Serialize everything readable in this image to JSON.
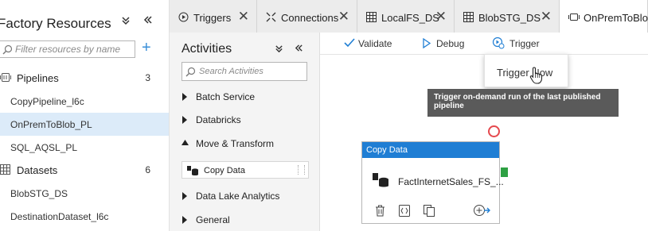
{
  "factory_resources": {
    "title": "Factory Resources",
    "search_placeholder": "Filter resources by name",
    "add_label": "+",
    "groups": [
      {
        "label": "Pipelines",
        "count": "3",
        "icon": "pipeline-icon"
      },
      {
        "label": "Datasets",
        "count": "6",
        "icon": "dataset-table-icon"
      }
    ],
    "pipelines": [
      "CopyPipeline_l6c",
      "OnPremToBlob_PL",
      "SQL_AQSL_PL"
    ],
    "datasets": [
      "BlobSTG_DS",
      "DestinationDataset_l6c"
    ],
    "selected_item": "OnPremToBlob_PL"
  },
  "tabs": [
    {
      "label": "Triggers",
      "icon": "trigger-icon",
      "closable": true
    },
    {
      "label": "Connections",
      "icon": "connections-icon",
      "closable": true
    },
    {
      "label": "LocalFS_DS",
      "icon": "dataset-table-icon",
      "closable": true
    },
    {
      "label": "BlobSTG_DS",
      "icon": "dataset-table-icon",
      "closable": true
    },
    {
      "label": "OnPremToBlob",
      "icon": "pipeline-icon",
      "closable": false
    }
  ],
  "tab_close_glyph": "✕",
  "activities": {
    "title": "Activities",
    "search_placeholder": "Search Activities",
    "categories": [
      {
        "label": "Batch Service",
        "expanded": false
      },
      {
        "label": "Databricks",
        "expanded": false
      },
      {
        "label": "Move & Transform",
        "expanded": true
      },
      {
        "label": "Data Lake Analytics",
        "expanded": false
      },
      {
        "label": "General",
        "expanded": false
      }
    ],
    "copy_data_label": "Copy Data"
  },
  "toolbar": {
    "validate_label": "Validate",
    "debug_label": "Debug",
    "trigger_label": "Trigger"
  },
  "trigger_menu": {
    "trigger_now_label": "Trigger Now"
  },
  "tooltip": {
    "text": "Trigger on-demand run of the last published pipeline"
  },
  "activity_box": {
    "header": "Copy Data",
    "name": "FactInternetSales_FS_..."
  },
  "glyphs": {
    "collapse_down": "≚",
    "collapse_left": "«",
    "collapsed_triangle": "▶",
    "expanded_triangle": "◀"
  },
  "colors": {
    "accent": "#1f7ed4",
    "selection": "#dcebf9",
    "success_port": "#2ea043",
    "error_port": "#e5484d",
    "tooltip_bg": "#5a5a5a"
  }
}
